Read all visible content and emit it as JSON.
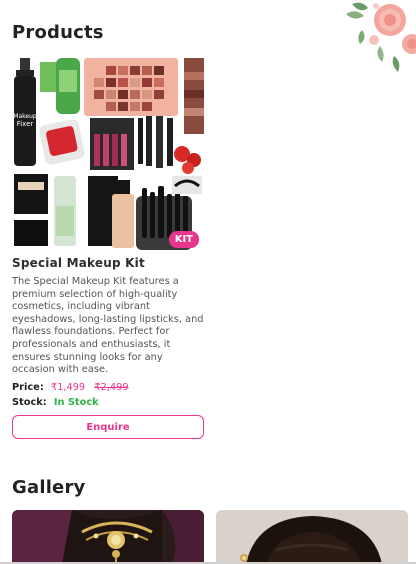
{
  "products": {
    "section_title": "Products",
    "item": {
      "name": "Special Makeup Kit",
      "badge": "KIT",
      "image_text": {
        "fixer_line1": "Makeup",
        "fixer_line2": "Fixer"
      },
      "description": "The Special Makeup Kit features a premium selection of high-quality cosmetics, including vibrant eyeshadows, long-lasting lipsticks, and flawless foundations. Perfect for professionals and enthusiasts, it ensures stunning looks for any occasion with ease.",
      "price_label": "Price:",
      "price_sale": "₹1,499",
      "price_original": "₹2,499",
      "stock_label": "Stock:",
      "stock_value": "In Stock",
      "enquire_label": "Enquire"
    }
  },
  "gallery": {
    "section_title": "Gallery"
  },
  "colors": {
    "accent": "#e8368f",
    "stock_green": "#2fb34a"
  }
}
